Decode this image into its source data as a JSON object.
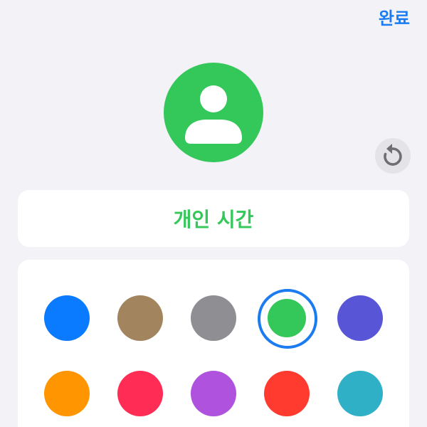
{
  "header": {
    "done_label": "완료"
  },
  "avatar": {
    "icon": "person-icon",
    "color": "#34c759"
  },
  "reset": {
    "icon": "reset-icon"
  },
  "name_field": {
    "value": "개인 시간",
    "color": "#34c759"
  },
  "palette": {
    "selected_index": 3,
    "colors": [
      "#0a7aff",
      "#a2845e",
      "#8e8e93",
      "#34c759",
      "#5856d6",
      "#ff9500",
      "#ff2d55",
      "#af52de",
      "#ff3b30",
      "#30b0c7"
    ]
  }
}
